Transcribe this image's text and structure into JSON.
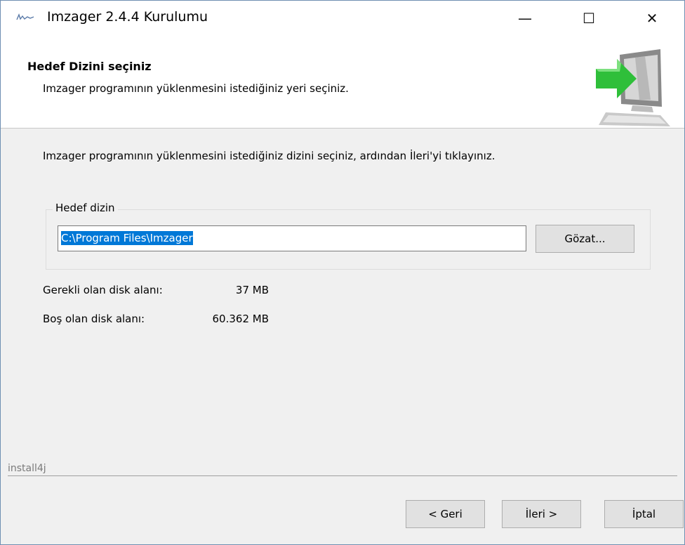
{
  "window": {
    "title": "Imzager 2.4.4 Kurulumu",
    "controls": {
      "minimize": "—",
      "maximize": "☐",
      "close": "✕"
    }
  },
  "header": {
    "title": "Hedef Dizini seçiniz",
    "subtitle": "Imzager programının yüklenmesini istediğiniz yeri seçiniz.",
    "image_icon": "computer-with-green-arrow-icon"
  },
  "content": {
    "instruction": "Imzager programının yüklenmesini istediğiniz dizini seçiniz, ardından İleri'yi tıklayınız.",
    "group_label": "Hedef dizin",
    "directory_value": "C:\\Program Files\\Imzager",
    "browse_label": "Gözat...",
    "required_label": "Gerekli olan disk alanı:",
    "required_value": "37 MB",
    "free_label": "Boş olan disk alanı:",
    "free_value": "60.362 MB"
  },
  "footer": {
    "brand": "install4j",
    "back_label": "< Geri",
    "next_label": "İleri >",
    "cancel_label": "İptal"
  },
  "colors": {
    "accent_selection": "#0078d7",
    "arrow_green": "#2fbf3a",
    "window_border": "#6f8fb2"
  }
}
